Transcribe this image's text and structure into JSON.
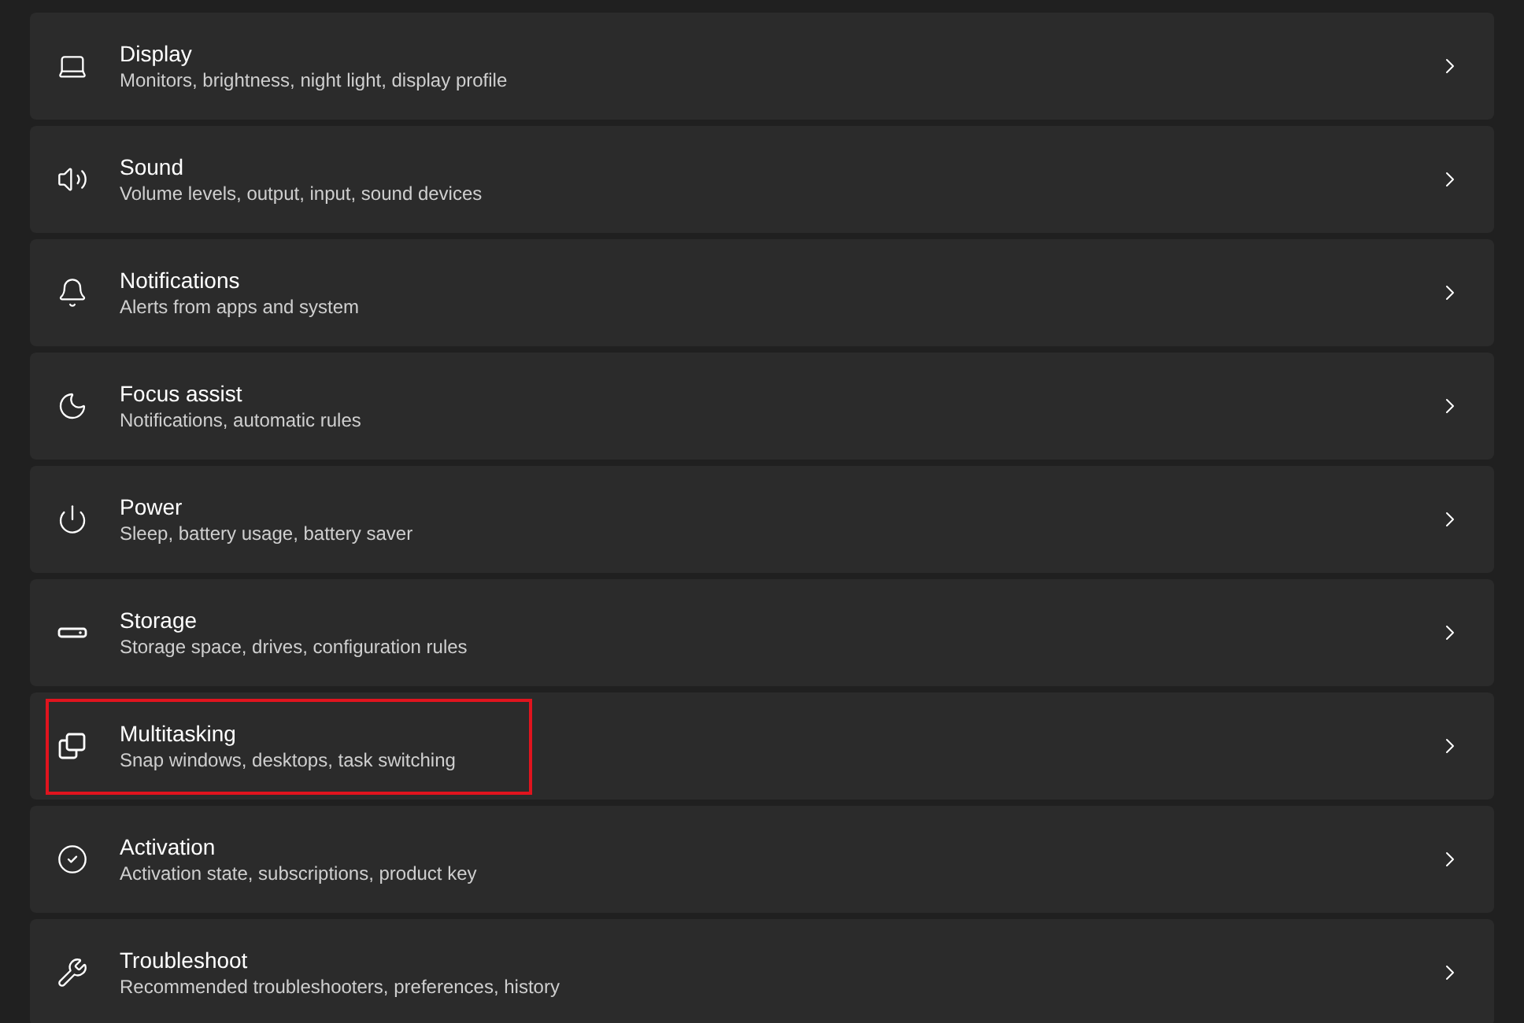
{
  "settings_items": [
    {
      "kind": "display",
      "title": "Display",
      "subtitle": "Monitors, brightness, night light, display profile",
      "highlighted": false
    },
    {
      "kind": "sound",
      "title": "Sound",
      "subtitle": "Volume levels, output, input, sound devices",
      "highlighted": false
    },
    {
      "kind": "notifications",
      "title": "Notifications",
      "subtitle": "Alerts from apps and system",
      "highlighted": false
    },
    {
      "kind": "focus",
      "title": "Focus assist",
      "subtitle": "Notifications, automatic rules",
      "highlighted": false
    },
    {
      "kind": "power",
      "title": "Power",
      "subtitle": "Sleep, battery usage, battery saver",
      "highlighted": false
    },
    {
      "kind": "storage",
      "title": "Storage",
      "subtitle": "Storage space, drives, configuration rules",
      "highlighted": false
    },
    {
      "kind": "multitasking",
      "title": "Multitasking",
      "subtitle": "Snap windows, desktops, task switching",
      "highlighted": true
    },
    {
      "kind": "activation",
      "title": "Activation",
      "subtitle": "Activation state, subscriptions, product key",
      "highlighted": false
    },
    {
      "kind": "troubleshoot",
      "title": "Troubleshoot",
      "subtitle": "Recommended troubleshooters, preferences, history",
      "highlighted": false
    }
  ]
}
